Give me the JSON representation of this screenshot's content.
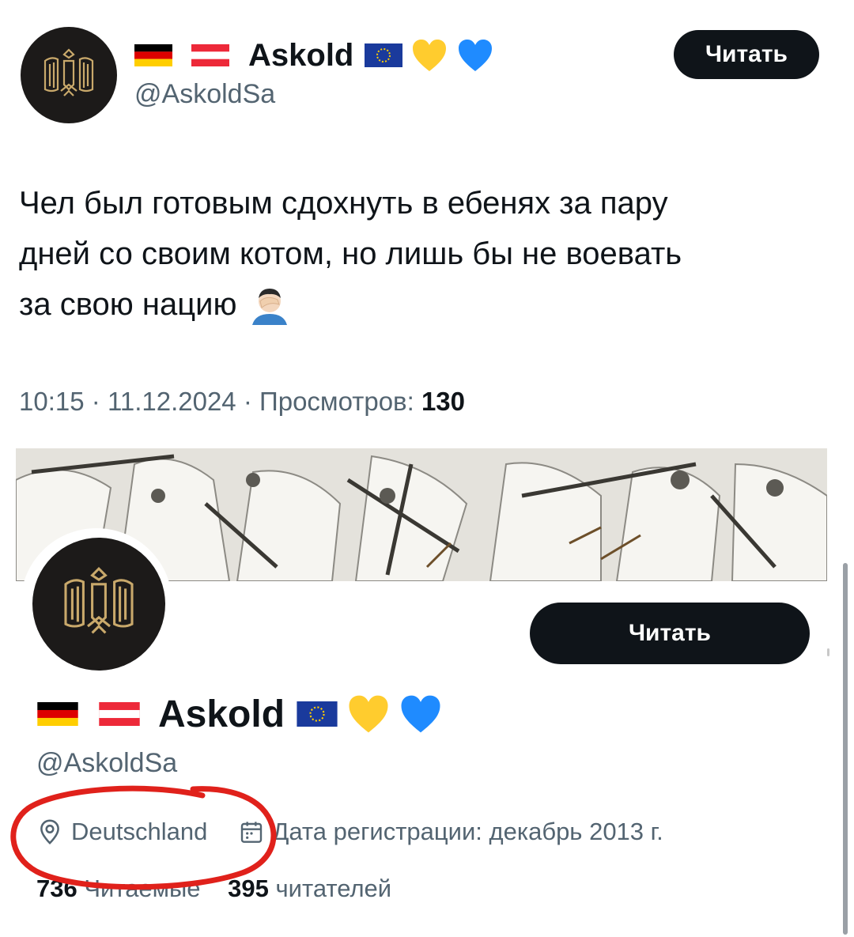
{
  "tweet": {
    "display_name": "Askold",
    "handle": "@AskoldSa",
    "follow_label": "Читать",
    "text_lines": [
      "Чел был готовым сдохнуть в ебенях за пару",
      "дней со своим котом, но лишь бы не воевать",
      "за свою нацию"
    ],
    "time": "10:15",
    "date": "11.12.2024",
    "views_label": "Просмотров:",
    "views_count": "130",
    "separator": "·"
  },
  "profile": {
    "display_name": "Askold",
    "handle": "@AskoldSa",
    "follow_label": "Читать",
    "location": "Deutschland",
    "joined": "Дата регистрации: декабрь 2013 г.",
    "following_count": "736",
    "following_label": "Читаемые",
    "followers_count": "395",
    "followers_label": "читателей"
  },
  "icons": {
    "name_badges": [
      "flag-germany-icon",
      "flag-austria-icon",
      "flag-eu-icon",
      "yellow-heart-icon",
      "blue-heart-icon"
    ],
    "tweet_emoji": "facepalm-emoji-icon",
    "location": "location-pin-icon",
    "calendar": "calendar-icon"
  },
  "colors": {
    "text": "#0f1419",
    "secondary": "#536471",
    "button": "#0f1419",
    "annotation": "#e0211b"
  }
}
